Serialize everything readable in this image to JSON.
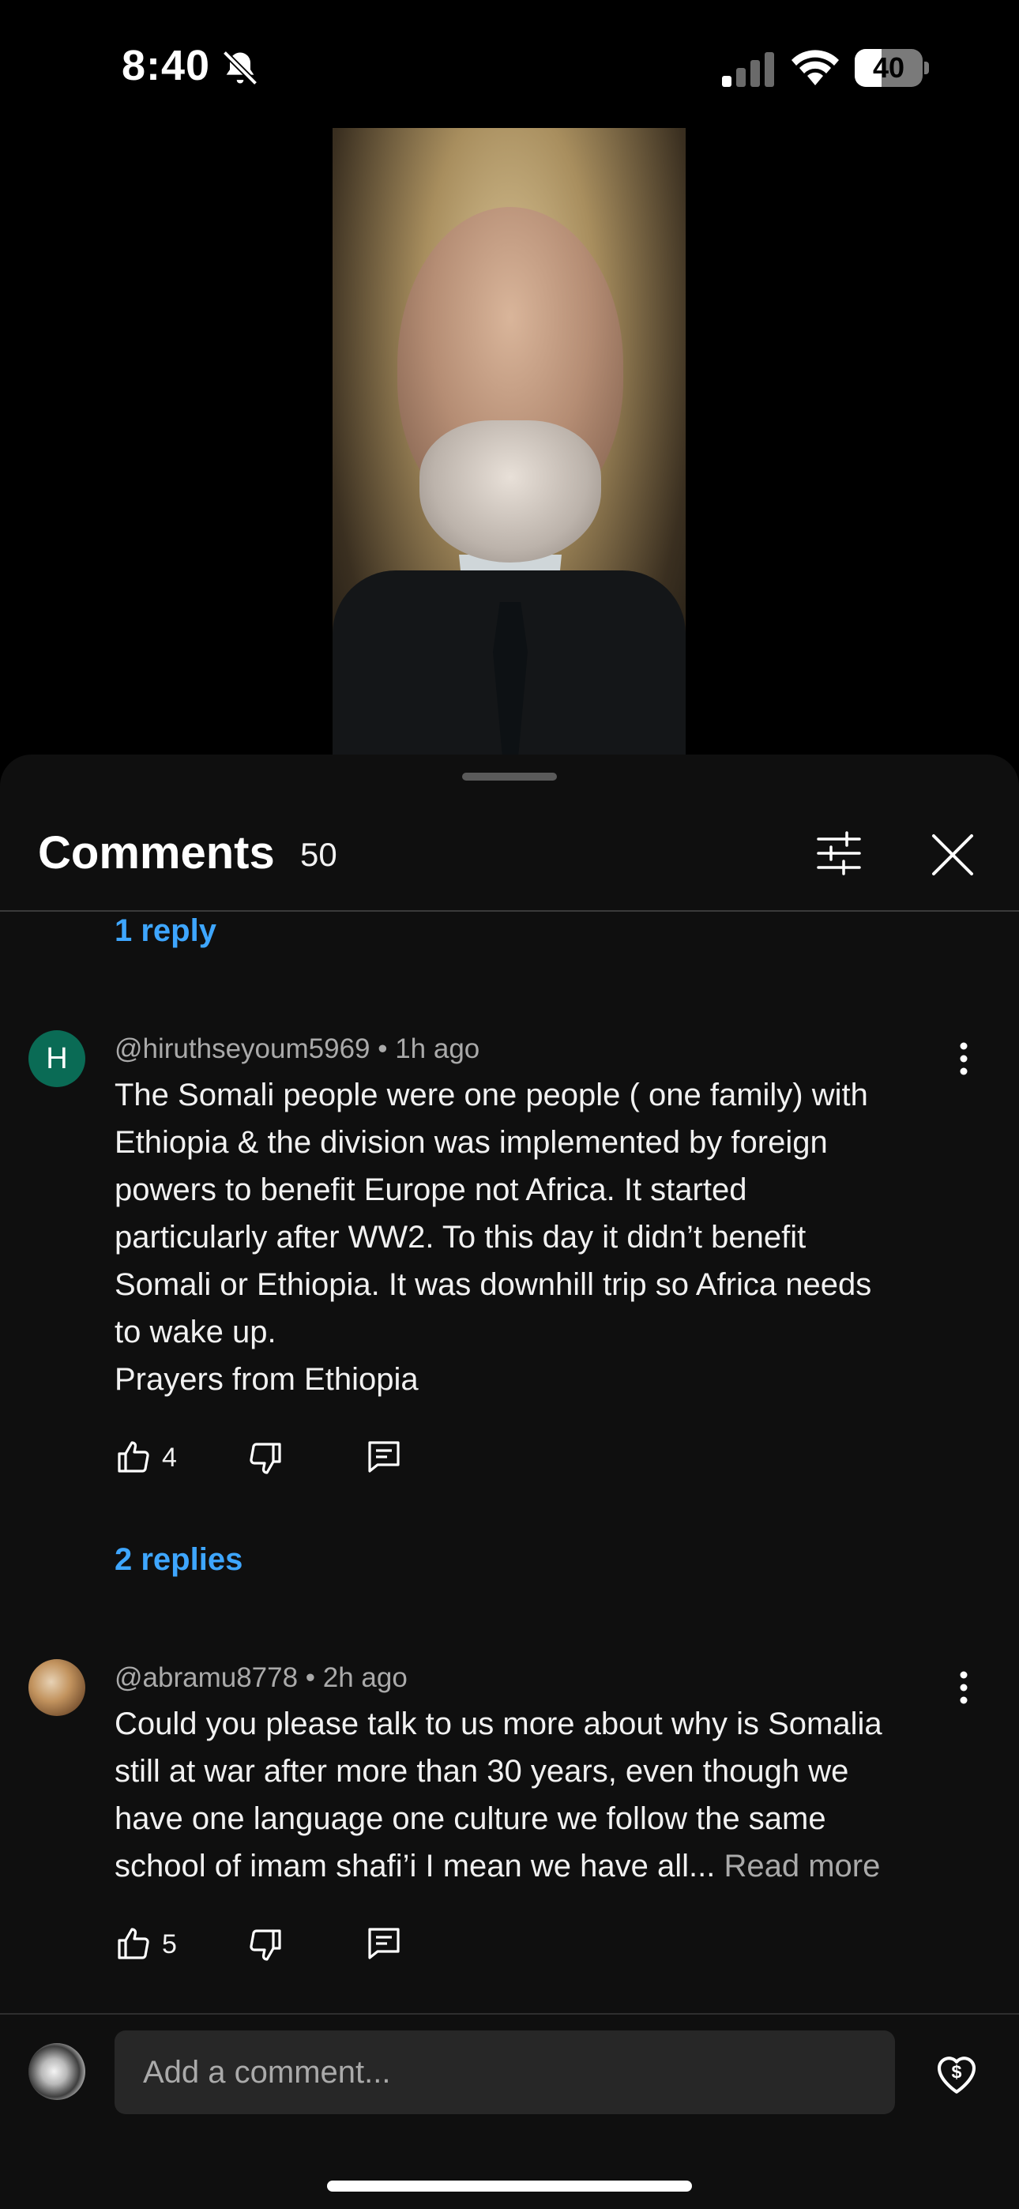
{
  "status_bar": {
    "time": "8:40",
    "battery": "40",
    "battery_level": 0.4
  },
  "comments_panel": {
    "title": "Comments",
    "count": "50",
    "prev_replies": "1 reply",
    "comments": [
      {
        "avatar_letter": "H",
        "author": "@hiruthseyoum5969",
        "time": "1h ago",
        "meta": "@hiruthseyoum5969 • 1h ago",
        "text": "The Somali people were one people ( one family) with\nEthiopia & the division was implemented by foreign\npowers to benefit Europe not Africa. It started\nparticularly after WW2. To this day it didn’t benefit\nSomali or Ethiopia. It was downhill trip so Africa needs\nto wake up.\nPrayers from Ethiopia",
        "likes": "4",
        "replies": "2 replies"
      },
      {
        "author": "@abramu8778",
        "time": "2h ago",
        "meta": "@abramu8778 • 2h ago",
        "text": "Could you please talk to us more about why is Somalia\nstill at war after more than 30 years, even though we\nhave one language one culture we follow the same\nschool of imam shafi’i I mean we have all... ",
        "read_more": "Read more",
        "likes": "5"
      }
    ]
  },
  "composer": {
    "placeholder": "Add a comment..."
  },
  "colors": {
    "accent": "#3ea6ff",
    "sheet_bg": "#0f0f0f",
    "input_bg": "#272727"
  },
  "icons": [
    "bell-off-icon",
    "signal-icon",
    "wifi-icon",
    "battery-icon",
    "filter-icon",
    "close-icon",
    "more-vert-icon",
    "like-icon",
    "dislike-icon",
    "reply-icon",
    "thanks-icon"
  ]
}
